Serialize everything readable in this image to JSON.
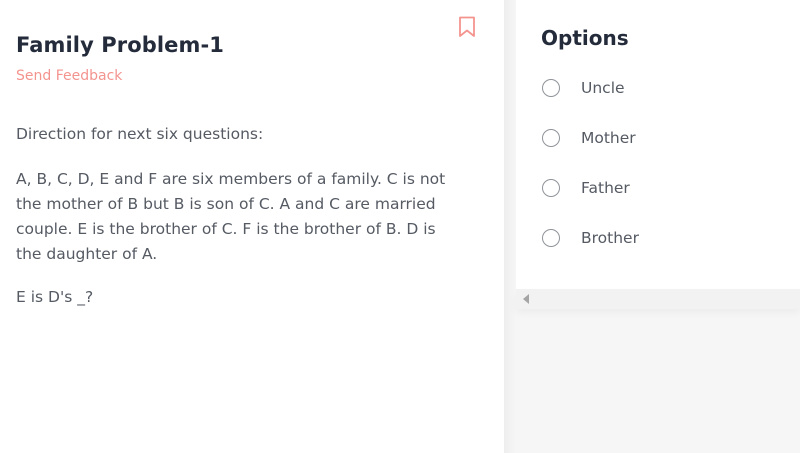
{
  "question": {
    "title": "Family Problem-1",
    "feedback_label": "Send Feedback",
    "direction": "Direction for next six questions:",
    "passage": "A, B, C, D, E and F are six members of a family. C is not the mother of B but B is son of C. A and C are married couple. E is the brother of C. F is the brother of B. D is the daughter of A.",
    "prompt": "E is D's _?"
  },
  "options_panel": {
    "title": "Options",
    "items": [
      {
        "label": "Uncle"
      },
      {
        "label": "Mother"
      },
      {
        "label": "Father"
      },
      {
        "label": "Brother"
      }
    ]
  },
  "icons": {
    "bookmark": "bookmark-icon",
    "scroll_left": "scroll-left-icon"
  },
  "colors": {
    "title": "#242b3a",
    "body_text": "#555a63",
    "accent": "#f4948f",
    "panel_bg": "#f6f6f6",
    "card_bg": "#ffffff"
  }
}
